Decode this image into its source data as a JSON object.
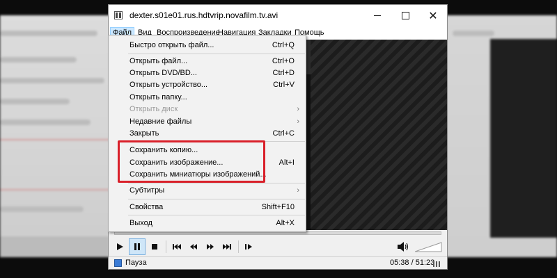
{
  "window": {
    "title": "dexter.s01e01.rus.hdtvrip.novafilm.tv.avi"
  },
  "menubar": {
    "items": [
      {
        "label": "Файл"
      },
      {
        "label": "Вид"
      },
      {
        "label": "Воспроизведение"
      },
      {
        "label": "Навигация"
      },
      {
        "label": "Закладки"
      },
      {
        "label": "Помощь"
      }
    ]
  },
  "file_menu": {
    "items": [
      {
        "label": "Быстро открыть файл...",
        "shortcut": "Ctrl+Q"
      },
      {
        "label": "Открыть файл...",
        "shortcut": "Ctrl+O"
      },
      {
        "label": "Открыть DVD/BD...",
        "shortcut": "Ctrl+D"
      },
      {
        "label": "Открыть устройство...",
        "shortcut": "Ctrl+V"
      },
      {
        "label": "Открыть папку...",
        "shortcut": ""
      },
      {
        "label": "Открыть диск",
        "shortcut": "",
        "submenu": true,
        "disabled": true
      },
      {
        "label": "Недавние файлы",
        "shortcut": "",
        "submenu": true
      },
      {
        "label": "Закрыть",
        "shortcut": "Ctrl+C"
      },
      {
        "label": "Сохранить копию...",
        "shortcut": ""
      },
      {
        "label": "Сохранить изображение...",
        "shortcut": "Alt+I"
      },
      {
        "label": "Сохранить миниатюры изображений...",
        "shortcut": ""
      },
      {
        "label": "Субтитры",
        "shortcut": "",
        "submenu": true
      },
      {
        "label": "Свойства",
        "shortcut": "Shift+F10"
      },
      {
        "label": "Выход",
        "shortcut": "Alt+X"
      }
    ],
    "submenu_arrow": "›"
  },
  "status": {
    "text": "Пауза",
    "time": "05:38 / 51:23"
  },
  "colors": {
    "highlight_border": "#d9202a",
    "menu_active": "#cce8ff",
    "pause_pressed": "#cfe6f8"
  },
  "icons": [
    "app-icon",
    "minimize-icon",
    "maximize-icon",
    "close-icon",
    "play-icon",
    "pause-icon",
    "stop-icon",
    "skip-back-icon",
    "rewind-icon",
    "fast-forward-icon",
    "skip-forward-icon",
    "frame-step-icon",
    "volume-icon"
  ]
}
